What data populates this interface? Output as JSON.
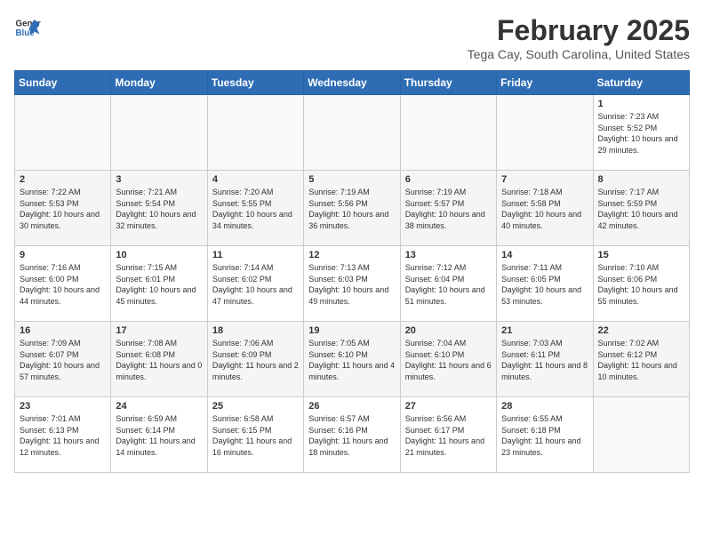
{
  "header": {
    "logo_general": "General",
    "logo_blue": "Blue",
    "title": "February 2025",
    "subtitle": "Tega Cay, South Carolina, United States"
  },
  "calendar": {
    "weekdays": [
      "Sunday",
      "Monday",
      "Tuesday",
      "Wednesday",
      "Thursday",
      "Friday",
      "Saturday"
    ],
    "weeks": [
      [
        {
          "day": "",
          "info": ""
        },
        {
          "day": "",
          "info": ""
        },
        {
          "day": "",
          "info": ""
        },
        {
          "day": "",
          "info": ""
        },
        {
          "day": "",
          "info": ""
        },
        {
          "day": "",
          "info": ""
        },
        {
          "day": "1",
          "info": "Sunrise: 7:23 AM\nSunset: 5:52 PM\nDaylight: 10 hours and 29 minutes."
        }
      ],
      [
        {
          "day": "2",
          "info": "Sunrise: 7:22 AM\nSunset: 5:53 PM\nDaylight: 10 hours and 30 minutes."
        },
        {
          "day": "3",
          "info": "Sunrise: 7:21 AM\nSunset: 5:54 PM\nDaylight: 10 hours and 32 minutes."
        },
        {
          "day": "4",
          "info": "Sunrise: 7:20 AM\nSunset: 5:55 PM\nDaylight: 10 hours and 34 minutes."
        },
        {
          "day": "5",
          "info": "Sunrise: 7:19 AM\nSunset: 5:56 PM\nDaylight: 10 hours and 36 minutes."
        },
        {
          "day": "6",
          "info": "Sunrise: 7:19 AM\nSunset: 5:57 PM\nDaylight: 10 hours and 38 minutes."
        },
        {
          "day": "7",
          "info": "Sunrise: 7:18 AM\nSunset: 5:58 PM\nDaylight: 10 hours and 40 minutes."
        },
        {
          "day": "8",
          "info": "Sunrise: 7:17 AM\nSunset: 5:59 PM\nDaylight: 10 hours and 42 minutes."
        }
      ],
      [
        {
          "day": "9",
          "info": "Sunrise: 7:16 AM\nSunset: 6:00 PM\nDaylight: 10 hours and 44 minutes."
        },
        {
          "day": "10",
          "info": "Sunrise: 7:15 AM\nSunset: 6:01 PM\nDaylight: 10 hours and 45 minutes."
        },
        {
          "day": "11",
          "info": "Sunrise: 7:14 AM\nSunset: 6:02 PM\nDaylight: 10 hours and 47 minutes."
        },
        {
          "day": "12",
          "info": "Sunrise: 7:13 AM\nSunset: 6:03 PM\nDaylight: 10 hours and 49 minutes."
        },
        {
          "day": "13",
          "info": "Sunrise: 7:12 AM\nSunset: 6:04 PM\nDaylight: 10 hours and 51 minutes."
        },
        {
          "day": "14",
          "info": "Sunrise: 7:11 AM\nSunset: 6:05 PM\nDaylight: 10 hours and 53 minutes."
        },
        {
          "day": "15",
          "info": "Sunrise: 7:10 AM\nSunset: 6:06 PM\nDaylight: 10 hours and 55 minutes."
        }
      ],
      [
        {
          "day": "16",
          "info": "Sunrise: 7:09 AM\nSunset: 6:07 PM\nDaylight: 10 hours and 57 minutes."
        },
        {
          "day": "17",
          "info": "Sunrise: 7:08 AM\nSunset: 6:08 PM\nDaylight: 11 hours and 0 minutes."
        },
        {
          "day": "18",
          "info": "Sunrise: 7:06 AM\nSunset: 6:09 PM\nDaylight: 11 hours and 2 minutes."
        },
        {
          "day": "19",
          "info": "Sunrise: 7:05 AM\nSunset: 6:10 PM\nDaylight: 11 hours and 4 minutes."
        },
        {
          "day": "20",
          "info": "Sunrise: 7:04 AM\nSunset: 6:10 PM\nDaylight: 11 hours and 6 minutes."
        },
        {
          "day": "21",
          "info": "Sunrise: 7:03 AM\nSunset: 6:11 PM\nDaylight: 11 hours and 8 minutes."
        },
        {
          "day": "22",
          "info": "Sunrise: 7:02 AM\nSunset: 6:12 PM\nDaylight: 11 hours and 10 minutes."
        }
      ],
      [
        {
          "day": "23",
          "info": "Sunrise: 7:01 AM\nSunset: 6:13 PM\nDaylight: 11 hours and 12 minutes."
        },
        {
          "day": "24",
          "info": "Sunrise: 6:59 AM\nSunset: 6:14 PM\nDaylight: 11 hours and 14 minutes."
        },
        {
          "day": "25",
          "info": "Sunrise: 6:58 AM\nSunset: 6:15 PM\nDaylight: 11 hours and 16 minutes."
        },
        {
          "day": "26",
          "info": "Sunrise: 6:57 AM\nSunset: 6:16 PM\nDaylight: 11 hours and 18 minutes."
        },
        {
          "day": "27",
          "info": "Sunrise: 6:56 AM\nSunset: 6:17 PM\nDaylight: 11 hours and 21 minutes."
        },
        {
          "day": "28",
          "info": "Sunrise: 6:55 AM\nSunset: 6:18 PM\nDaylight: 11 hours and 23 minutes."
        },
        {
          "day": "",
          "info": ""
        }
      ]
    ]
  }
}
